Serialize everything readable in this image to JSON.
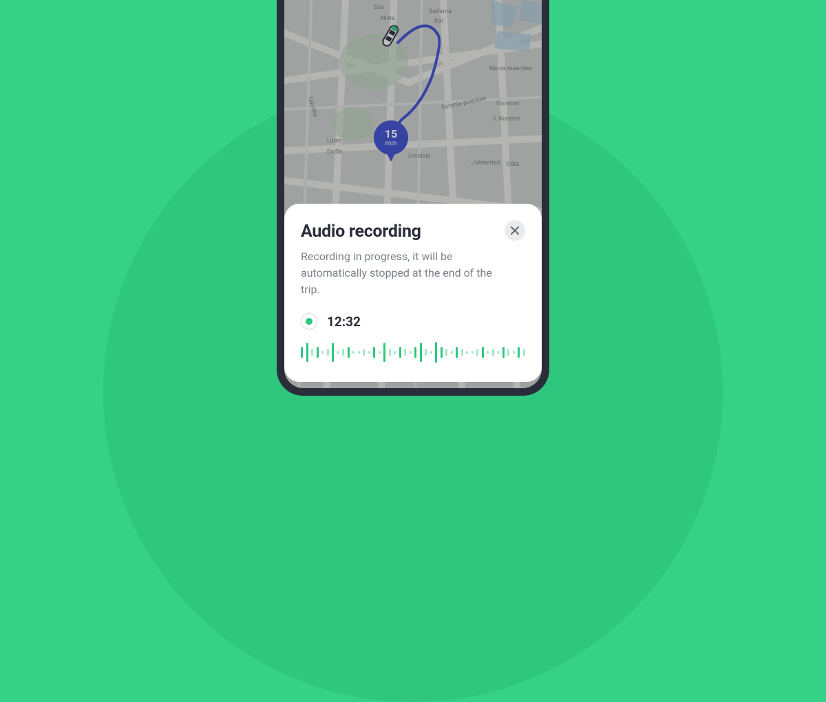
{
  "colors": {
    "brand_green": "#34D186",
    "brand_green_dark": "#2EC77D",
    "route_blue": "#3B4CCA",
    "text_primary": "#2A2E3A",
    "text_secondary": "#7B8088"
  },
  "map": {
    "eta": {
      "value": "15",
      "unit": "min"
    },
    "streets": [
      "Soo",
      "Niine",
      "Sadama",
      "Kai",
      "Narva maantee",
      "Estonia puiestee",
      "Gonsiori",
      "J. Kunderi",
      "Juhkentali",
      "Odra",
      "Liivalaia",
      "Tehnika",
      "Luise",
      "Endla"
    ]
  },
  "sheet": {
    "title": "Audio recording",
    "description": "Recording in progress, it will be automatically stopped at the end of the trip.",
    "elapsed": "12:32"
  }
}
